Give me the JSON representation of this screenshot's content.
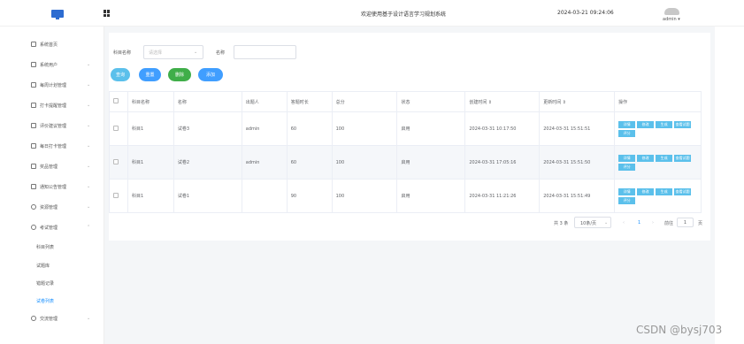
{
  "topbar": {
    "welcome": "欢迎使用基于设计语言学习规划系统",
    "datetime": "2024-03-21 09:24:06",
    "user": "admin ▾"
  },
  "sidebar": {
    "items": [
      {
        "label": "系统首页"
      },
      {
        "label": "系统用户",
        "arrow": "⌄"
      },
      {
        "label": "每周计划管理",
        "arrow": "⌄"
      },
      {
        "label": "打卡提醒管理",
        "arrow": "⌄"
      },
      {
        "label": "评价建议管理",
        "arrow": "⌄"
      },
      {
        "label": "每日打卡管理",
        "arrow": "⌄"
      },
      {
        "label": "奖品管理",
        "arrow": "⌄"
      },
      {
        "label": "通知公告管理",
        "arrow": "⌄"
      },
      {
        "label": "资源管理",
        "arrow": "⌄"
      },
      {
        "label": "考试管理",
        "arrow": "⌃"
      },
      {
        "label": "交流管理",
        "arrow": "⌄"
      }
    ],
    "sub": [
      "科目列表",
      "试题库",
      "错题记录",
      "试卷列表"
    ]
  },
  "search": {
    "subject_label": "科目名称",
    "subject_placeholder": "请选择",
    "chev": "⌄",
    "name_label": "名称"
  },
  "buttons": {
    "query": "查询",
    "reset": "重置",
    "delete": "删除",
    "add": "添加"
  },
  "table": {
    "headers": [
      "科目名称",
      "名称",
      "出题人",
      "答题时长",
      "总分",
      "状态",
      "创建时间 ⇕",
      "更新时间 ⇕",
      "操作"
    ],
    "row_actions": [
      "详情",
      "修改",
      "生成",
      "查看试题",
      "评分"
    ],
    "rows": [
      [
        "科目1",
        "试卷3",
        "admin",
        "60",
        "100",
        "启用",
        "2024-03-31 10:17:50",
        "2024-03-31 15:51:51"
      ],
      [
        "科目1",
        "试卷2",
        "admin",
        "60",
        "100",
        "启用",
        "2024-03-31 17:05:16",
        "2024-03-31 15:51:50"
      ],
      [
        "科目1",
        "试卷1",
        "",
        "90",
        "100",
        "启用",
        "2024-03-31 11:21:26",
        "2024-03-31 15:51:49"
      ]
    ]
  },
  "pagination": {
    "total": "共 3 条",
    "per_page": "10条/页",
    "chev": "⌄",
    "prev": "‹",
    "page": "1",
    "next": "›",
    "goto": "前往",
    "goto_value": "1",
    "page_unit": "页"
  },
  "watermark": "CSDN @bysj703",
  "colors": {
    "query": "#5bc0eb",
    "reset": "#409eff",
    "delete": "#3fae49",
    "add": "#409eff",
    "primary": "#1890ff"
  }
}
